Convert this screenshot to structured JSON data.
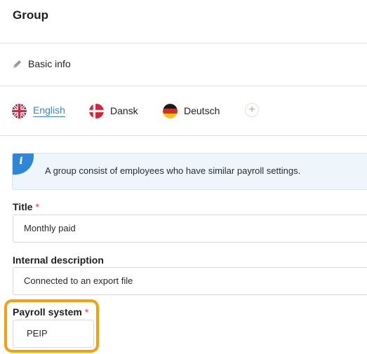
{
  "header": {
    "title": "Group"
  },
  "basic": {
    "label": "Basic info",
    "icon": "pencil-icon"
  },
  "languages": [
    {
      "name": "English",
      "flag": "uk-flag-icon",
      "active": true
    },
    {
      "name": "Dansk",
      "flag": "denmark-flag-icon",
      "active": false
    },
    {
      "name": "Deutsch",
      "flag": "germany-flag-icon",
      "active": false
    }
  ],
  "add_language": {
    "symbol": "+",
    "icon": "plus-icon"
  },
  "info": {
    "badge": "i",
    "text": "A group consist of employees who have similar payroll settings."
  },
  "fields": {
    "title": {
      "label": "Title",
      "required": "*",
      "value": "Monthly paid"
    },
    "description": {
      "label": "Internal description",
      "value": "Connected to an export file"
    },
    "payroll": {
      "label": "Payroll system",
      "required": "*",
      "value": "PEIP"
    }
  },
  "colors": {
    "accent": "#3b86c6",
    "info_badge": "#2f86d6",
    "highlight": "#f5a00f",
    "required": "#e0463c",
    "add": "#7cc46b"
  }
}
